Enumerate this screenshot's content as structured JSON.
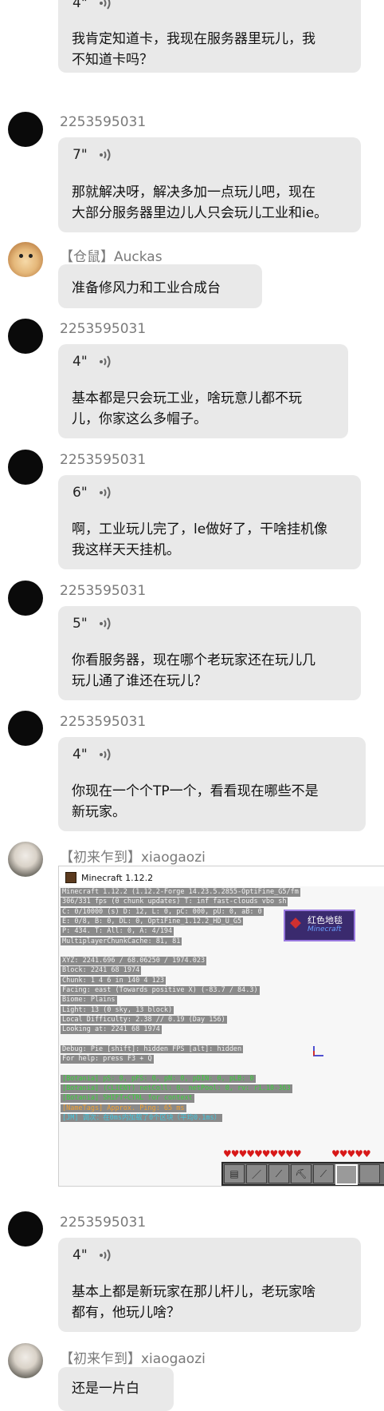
{
  "messages": [
    {
      "type": "voice",
      "duration": "4\"",
      "text_lines": [
        "我肯定知道卡，我现在服务器里玩儿，我",
        "不知道卡吗？"
      ]
    },
    {
      "type": "voice",
      "sender": "2253595031",
      "duration": "7\"",
      "text_lines": [
        "那就解决呀，解决多加一点玩儿吧，现在",
        "大部分服务器里边儿人只会玩儿工业和ie。"
      ]
    },
    {
      "type": "text",
      "sender": "【仓鼠】Auckas",
      "text": "准备修风力和工业合成台"
    },
    {
      "type": "voice",
      "sender": "2253595031",
      "duration": "4\"",
      "text_lines": [
        "基本都是只会玩工业，啥玩意儿都不玩",
        "儿，你家这么多帽子。"
      ]
    },
    {
      "type": "voice",
      "sender": "2253595031",
      "duration": "6\"",
      "text_lines": [
        "啊，工业玩儿完了，le做好了，干啥挂机像",
        "我这样天天挂机。"
      ]
    },
    {
      "type": "voice",
      "sender": "2253595031",
      "duration": "5\"",
      "text_lines": [
        "你看服务器，现在哪个老玩家还在玩儿几",
        "玩儿通了谁还在玩儿？"
      ]
    },
    {
      "type": "voice",
      "sender": "2253595031",
      "duration": "4\"",
      "text_lines": [
        "你现在一个个TP一个，看看现在哪些不是",
        "新玩家。"
      ]
    },
    {
      "type": "image",
      "sender": "【初来乍到】xiaogaozi"
    },
    {
      "type": "voice",
      "sender": "2253595031",
      "duration": "4\"",
      "text_lines": [
        "基本上都是新玩家在那儿杆儿，老玩家啥",
        "都有，他玩儿啥？"
      ]
    },
    {
      "type": "text",
      "sender": "【初来乍到】xiaogaozi",
      "text": "还是一片白"
    }
  ],
  "screenshot": {
    "window_title": "Minecraft 1.12.2",
    "debug_lines": [
      {
        "t": "Minecraft 1.12.2 (1.12.2-Forge 14.23.5.2855-OptiFine_G5/fm",
        "c": ""
      },
      {
        "t": "306/331 fps (0 chunk updates) T: inf fast-clouds vbo sh",
        "c": ""
      },
      {
        "t": "C: 0/10000 (s) D: 12, L: 0, pC: 000, pU: 0, aB: 0",
        "c": ""
      },
      {
        "t": "E: 0/8, B: 0, DL: 0, OptiFine_1.12.2_HD_U_G5",
        "c": ""
      },
      {
        "t": "P: 434. T: All: 0, A: 4/194",
        "c": ""
      },
      {
        "t": "MultiplayerChunkCache: 81, 81",
        "c": ""
      },
      {
        "t": "",
        "c": ""
      },
      {
        "t": "XYZ: 2241.696 / 68.06250 / 1974.023",
        "c": ""
      },
      {
        "t": "Block: 2241 68 1974",
        "c": ""
      },
      {
        "t": "Chunk: 1 4 6 in 140 4 123",
        "c": ""
      },
      {
        "t": "Facing: east (Towards positive X) (-83.7 / 84.3)",
        "c": ""
      },
      {
        "t": "Biome: Plains",
        "c": ""
      },
      {
        "t": "Light: 13 (0 sky, 13 block)",
        "c": ""
      },
      {
        "t": "Local Difficulty: 2.38 // 0.19 (Day 156)",
        "c": ""
      },
      {
        "t": "Looking at: 2241 68 1974",
        "c": ""
      },
      {
        "t": "",
        "c": ""
      },
      {
        "t": "Debug: Pie [shift]: hidden FPS [alt]: hidden",
        "c": ""
      },
      {
        "t": "For help: press F3 + Q",
        "c": ""
      },
      {
        "t": "",
        "c": ""
      },
      {
        "t": "[Botania] pS: 0, pFS: 0, pN: 0, pDIN: 0, pLB: 0",
        "c": "green"
      },
      {
        "t": "[Botania] (CLIENT) netColl: 0, netPool: 0, rv: r1.10-363",
        "c": "green"
      },
      {
        "t": "[Botania] SHIFT+CTRL for context",
        "c": "green"
      },
      {
        "t": "[NameTags] Approx. Ping: 65 ms",
        "c": "orange"
      },
      {
        "t": "[JM] 调次：在0ms内加载了0个区块（平均0.1ms）",
        "c": "cyan"
      }
    ],
    "badge_title": "红色地毯",
    "badge_sub": "Minecraft",
    "hearts_left": "♥♥♥♥♥♥♥♥♥♥",
    "hearts_right": "♥♥♥♥♥"
  }
}
